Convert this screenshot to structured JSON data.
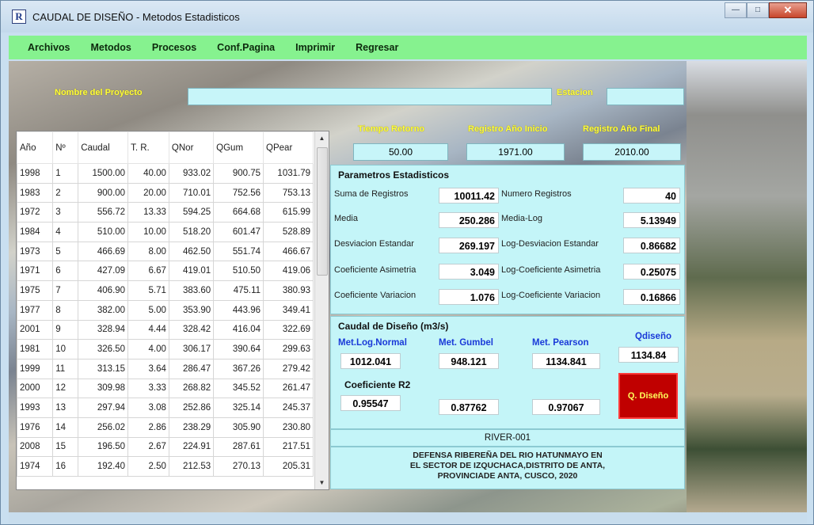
{
  "window": {
    "icon_letter": "R",
    "title": "CAUDAL DE DISEÑO - Metodos Estadisticos",
    "min_glyph": "—",
    "max_glyph": "□",
    "close_glyph": "✕"
  },
  "menu": [
    "Archivos",
    "Metodos",
    "Procesos",
    "Conf.Pagina",
    "Imprimir",
    "Regresar"
  ],
  "header": {
    "nombre_label": "Nombre del Proyecto",
    "nombre_value": "",
    "estacion_label": "Estacion",
    "estacion_value": "",
    "tiempo_label": "Tiempo Retorno",
    "tiempo_value": "50.00",
    "reg_inicio_label": "Registro Año Inicio",
    "reg_inicio_value": "1971.00",
    "reg_final_label": "Registro Año Final",
    "reg_final_value": "2010.00"
  },
  "table": {
    "columns": [
      "Año",
      "Nº",
      "Caudal",
      "T. R.",
      "QNor",
      "QGum",
      "QPear"
    ],
    "rows": [
      [
        "1998",
        "1",
        "1500.00",
        "40.00",
        "933.02",
        "900.75",
        "1031.79"
      ],
      [
        "1983",
        "2",
        "900.00",
        "20.00",
        "710.01",
        "752.56",
        "753.13"
      ],
      [
        "1972",
        "3",
        "556.72",
        "13.33",
        "594.25",
        "664.68",
        "615.99"
      ],
      [
        "1984",
        "4",
        "510.00",
        "10.00",
        "518.20",
        "601.47",
        "528.89"
      ],
      [
        "1973",
        "5",
        "466.69",
        "8.00",
        "462.50",
        "551.74",
        "466.67"
      ],
      [
        "1971",
        "6",
        "427.09",
        "6.67",
        "419.01",
        "510.50",
        "419.06"
      ],
      [
        "1975",
        "7",
        "406.90",
        "5.71",
        "383.60",
        "475.11",
        "380.93"
      ],
      [
        "1977",
        "8",
        "382.00",
        "5.00",
        "353.90",
        "443.96",
        "349.41"
      ],
      [
        "2001",
        "9",
        "328.94",
        "4.44",
        "328.42",
        "416.04",
        "322.69"
      ],
      [
        "1981",
        "10",
        "326.50",
        "4.00",
        "306.17",
        "390.64",
        "299.63"
      ],
      [
        "1999",
        "11",
        "313.15",
        "3.64",
        "286.47",
        "367.26",
        "279.42"
      ],
      [
        "2000",
        "12",
        "309.98",
        "3.33",
        "268.82",
        "345.52",
        "261.47"
      ],
      [
        "1993",
        "13",
        "297.94",
        "3.08",
        "252.86",
        "325.14",
        "245.37"
      ],
      [
        "1976",
        "14",
        "256.02",
        "2.86",
        "238.29",
        "305.90",
        "230.80"
      ],
      [
        "2008",
        "15",
        "196.50",
        "2.67",
        "224.91",
        "287.61",
        "217.51"
      ],
      [
        "1974",
        "16",
        "192.40",
        "2.50",
        "212.53",
        "270.13",
        "205.31"
      ]
    ]
  },
  "params": {
    "title": "Parametros Estadisticos",
    "suma_label": "Suma de Registros",
    "suma_value": "10011.42",
    "numero_label": "Numero Registros",
    "numero_value": "40",
    "media_label": "Media",
    "media_value": "250.286",
    "medialog_label": "Media-Log",
    "medialog_value": "5.13949",
    "desv_label": "Desviacion Estandar",
    "desv_value": "269.197",
    "logdesv_label": "Log-Desviacion Estandar",
    "logdesv_value": "0.86682",
    "asim_label": "Coeficiente Asimetria",
    "asim_value": "3.049",
    "logasim_label": "Log-Coeficiente Asimetria",
    "logasim_value": "0.25075",
    "var_label": "Coeficiente Variacion",
    "var_value": "1.076",
    "logvar_label": "Log-Coeficiente Variacion",
    "logvar_value": "0.16866"
  },
  "caudal": {
    "title": "Caudal de Diseño (m3/s)",
    "lognormal_label": "Met.Log.Normal",
    "lognormal_value": "1012.041",
    "gumbel_label": "Met. Gumbel",
    "gumbel_value": "948.121",
    "pearson_label": "Met. Pearson",
    "pearson_value": "1134.841",
    "qdiseno_label": "Qdiseño",
    "qdiseno_value": "1134.84",
    "r2_title": "Coeficiente R2",
    "r2_lognormal": "0.95547",
    "r2_gumbel": "0.87762",
    "r2_pearson": "0.97067",
    "button_label": "Q. Diseño"
  },
  "footer": {
    "code": "RIVER-001",
    "line1": "DEFENSA RIBEREÑA DEL RIO HATUNMAYO EN",
    "line2": "EL SECTOR DE IZQUCHACA,DISTRITO DE ANTA,",
    "line3": "PROVINCIADE ANTA, CUSCO, 2020"
  }
}
